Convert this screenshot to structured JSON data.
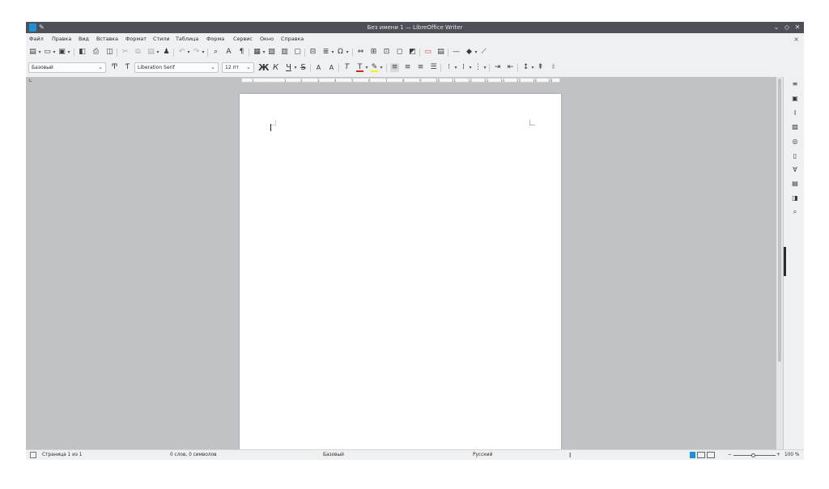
{
  "window": {
    "title": "Без имени 1 — LibreOffice Writer",
    "controls": {
      "minimize": "⌄",
      "restore": "◇",
      "close": "✕"
    }
  },
  "menu": {
    "items": [
      "Файл",
      "Правка",
      "Вид",
      "Вставка",
      "Формат",
      "Стили",
      "Таблица",
      "Форма",
      "Сервис",
      "Окно",
      "Справка"
    ],
    "close_document": "×"
  },
  "formatting": {
    "paragraph_style": "Базовый",
    "font_name": "Liberation Serif",
    "font_size": "12 пт",
    "bold": "Ж",
    "italic": "К",
    "underline": "Ч",
    "strikethrough": "S",
    "superscript": "A",
    "subscript": "A",
    "font_color": "#d9261c",
    "highlight_color": "#ffef00"
  },
  "ruler": {
    "ticks": [
      "1",
      "1",
      "2",
      "3",
      "4",
      "5",
      "6",
      "7",
      "8",
      "9",
      "10",
      "11",
      "12",
      "13",
      "14",
      "15",
      "16",
      "18"
    ]
  },
  "statusbar": {
    "page_info": "Страница 1 из 1",
    "word_count": "0 слов, 0 символов",
    "page_style": "Базовый",
    "language": "Русский",
    "zoom_level": "100 %",
    "zoom_minus": "−",
    "zoom_plus": "+"
  },
  "sidebar": {
    "icons": [
      "hamburger-icon",
      "properties-icon",
      "styles-icon",
      "gallery-icon",
      "navigator-icon",
      "page-icon",
      "style-inspector-icon",
      "manage-changes-icon",
      "design-icon",
      "find-icon"
    ]
  },
  "colors": {
    "titlebar": "#4d5157",
    "accent": "#1e8fd8",
    "workspace": "#c0c2c6"
  }
}
